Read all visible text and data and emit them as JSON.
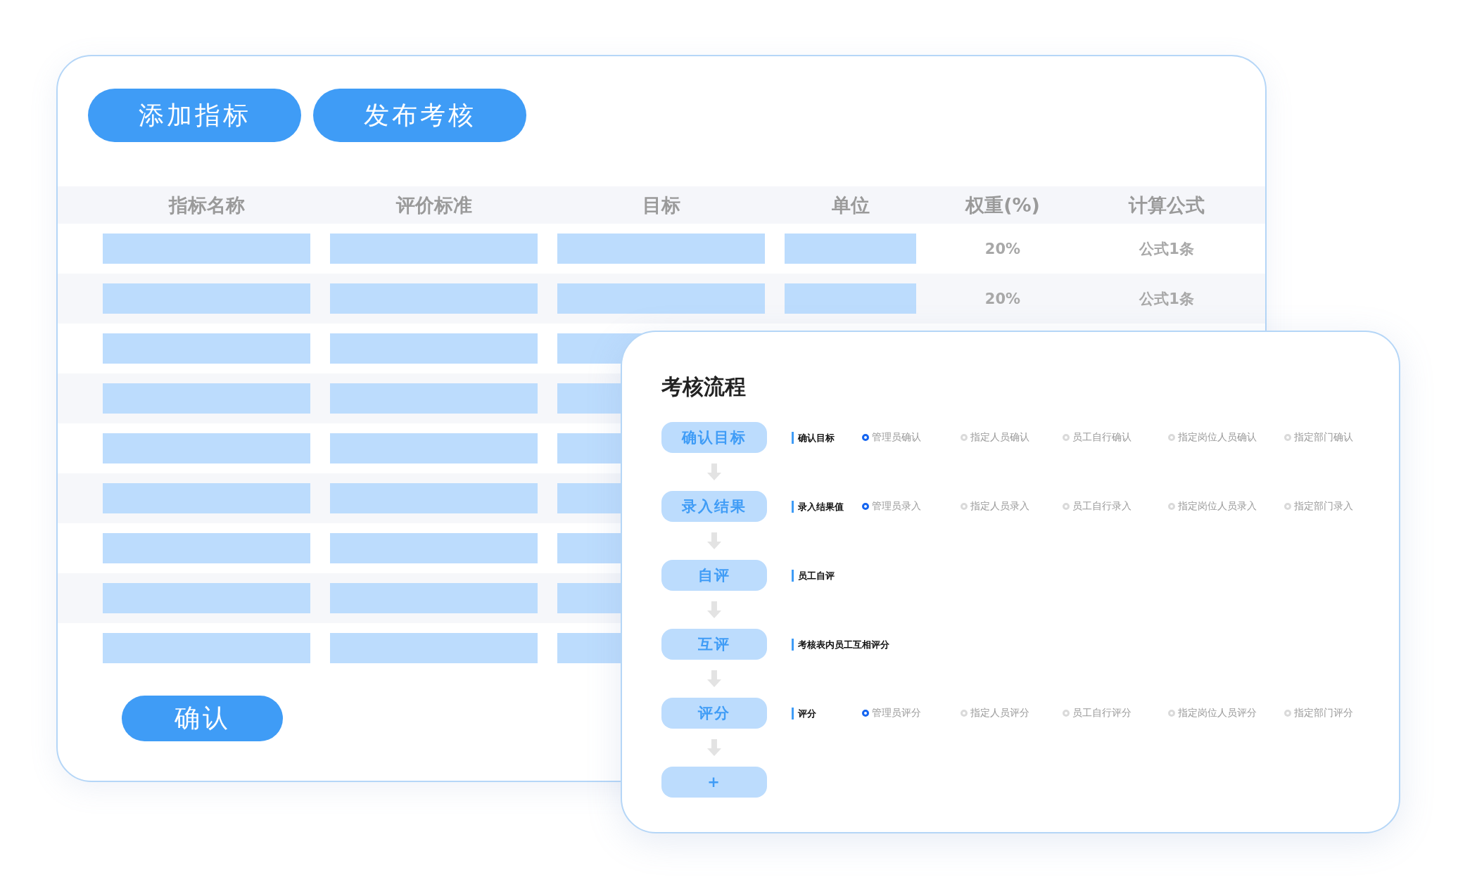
{
  "actions": [
    {
      "label": "添加指标"
    },
    {
      "label": "发布考核"
    }
  ],
  "table": {
    "columns": [
      "指标名称",
      "评价标准",
      "目标",
      "单位",
      "权重(%)",
      "计算公式"
    ],
    "rows": [
      {
        "kind": "text",
        "weight": "20%",
        "formula": "公式1条"
      },
      {
        "kind": "text",
        "weight": "20%",
        "formula": "公式1条"
      },
      {
        "kind": "blank"
      },
      {
        "kind": "blank"
      },
      {
        "kind": "blank"
      },
      {
        "kind": "blank"
      },
      {
        "kind": "blank"
      },
      {
        "kind": "blank"
      },
      {
        "kind": "blank"
      }
    ]
  },
  "confirm_button": {
    "label": "确认"
  },
  "flow": {
    "title": "考核流程",
    "steps": [
      {
        "label": "确认目标",
        "description": "确认目标",
        "options": [
          {
            "label": "管理员确认",
            "selected": true
          },
          {
            "label": "指定人员确认",
            "selected": false
          },
          {
            "label": "员工自行确认",
            "selected": false
          },
          {
            "label": "指定岗位人员确认",
            "selected": false
          },
          {
            "label": "指定部门确认",
            "selected": false
          }
        ]
      },
      {
        "label": "录入结果",
        "description": "录入结果值",
        "options": [
          {
            "label": "管理员录入",
            "selected": true
          },
          {
            "label": "指定人员录入",
            "selected": false
          },
          {
            "label": "员工自行录入",
            "selected": false
          },
          {
            "label": "指定岗位人员录入",
            "selected": false
          },
          {
            "label": "指定部门录入",
            "selected": false
          }
        ]
      },
      {
        "label": "自评",
        "description": "员工自评"
      },
      {
        "label": "互评",
        "description": "考核表内员工互相评分"
      },
      {
        "label": "评分",
        "description": "评分",
        "options": [
          {
            "label": "管理员评分",
            "selected": true
          },
          {
            "label": "指定人员评分",
            "selected": false
          },
          {
            "label": "员工自行评分",
            "selected": false
          },
          {
            "label": "指定岗位人员评分",
            "selected": false
          },
          {
            "label": "指定部门评分",
            "selected": false
          }
        ]
      }
    ],
    "add_button": "+"
  }
}
